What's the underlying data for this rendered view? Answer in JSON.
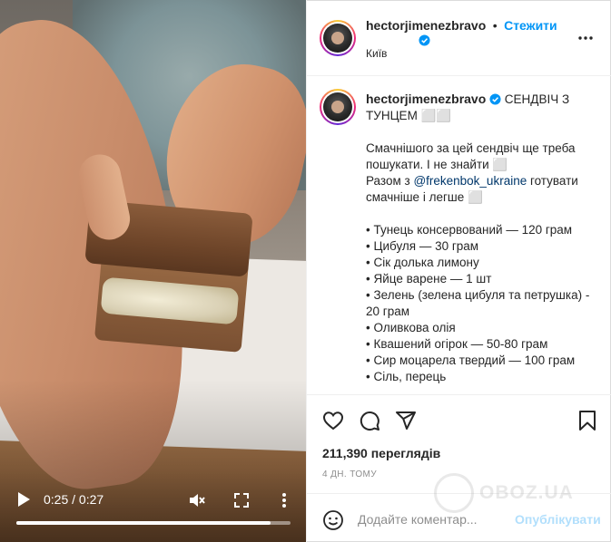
{
  "video": {
    "time_label": "0:25 / 0:27",
    "progress": 0.926,
    "icons": {
      "play": "play-icon",
      "mute": "mute-icon",
      "fullscreen": "fullscreen-icon",
      "more": "more-vertical-icon"
    }
  },
  "header": {
    "username": "hectorjimenezbravo",
    "dot": "•",
    "follow_label": "Стежити",
    "location": "Київ",
    "icons": {
      "verified": "verified-badge-icon",
      "more": "more-horizontal-icon"
    }
  },
  "caption": {
    "username": "hectorjimenezbravo",
    "title": "СЕНДВІЧ З ТУНЦЕМ ⬜⬜",
    "para1": "Смачнішого за цей сендвіч ще треба пошукати. І не знайти ⬜",
    "para2_prefix": "Разом з ",
    "mention": "@frekenbok_ukraine",
    "para2_suffix": " готувати смачніше і легше ⬜",
    "ingredients": [
      "• Тунець консервований — 120 грам",
      "• Цибуля — 30 грам",
      "• Сік долька лимону",
      "• Яйце варене — 1 шт",
      "• Зелень (зелена цибуля та петрушка) - 20 грам",
      "• Оливкова олія",
      "• Квашений огірок — 50-80 грам",
      "• Сир моцарела твердий — 100 грам",
      "• Сіль, перець"
    ]
  },
  "actions": {
    "icons": [
      "heart-icon",
      "comment-icon",
      "share-icon",
      "bookmark-icon"
    ]
  },
  "stats": {
    "views": "211,390 переглядів",
    "posted": "4 ДН. ТОМУ"
  },
  "comment": {
    "placeholder": "Додайте коментар...",
    "post_label": "Опублікувати",
    "icon": "emoji-icon"
  },
  "watermark": {
    "text": "OBOZ.UA"
  },
  "colors": {
    "accent": "#0095f6",
    "post_disabled": "#b2dffc",
    "text": "#262626",
    "muted": "#8e8e8e",
    "mention": "#00376b"
  }
}
